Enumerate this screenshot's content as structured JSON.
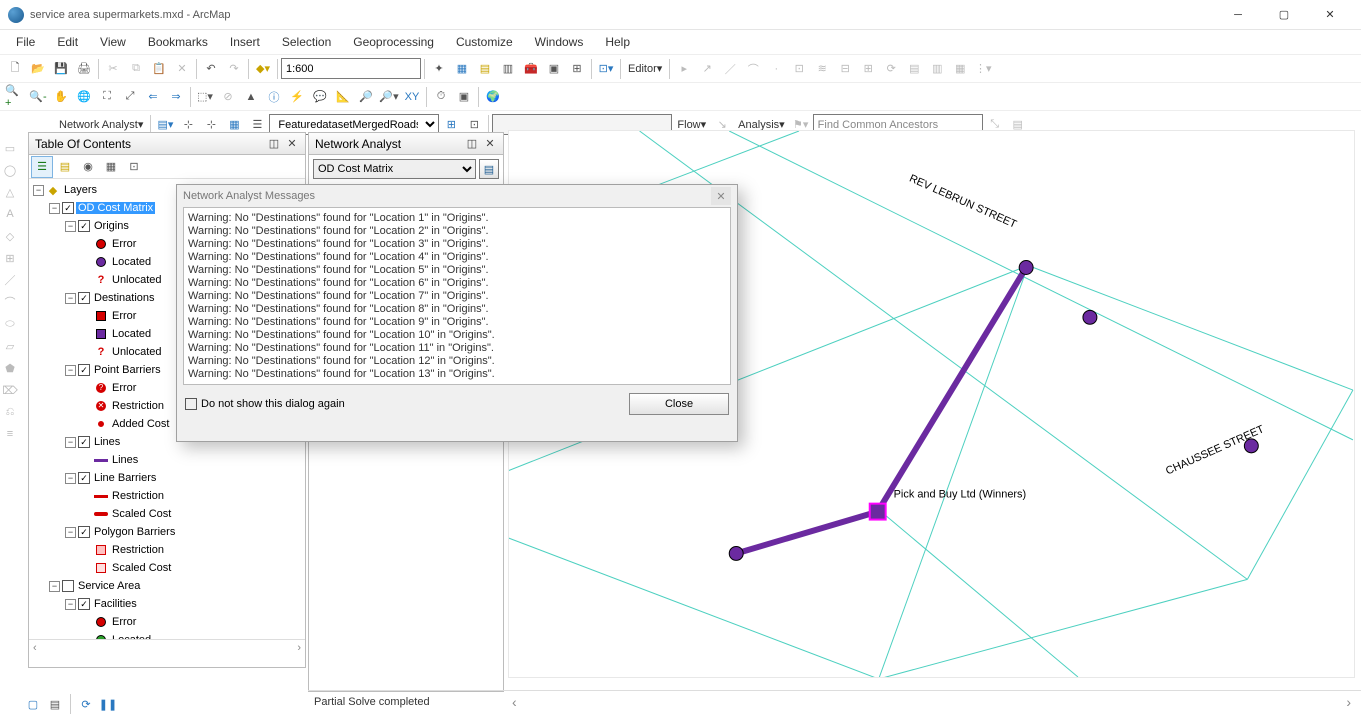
{
  "titlebar": {
    "title": "service area supermarkets.mxd - ArcMap"
  },
  "menubar": [
    "File",
    "Edit",
    "View",
    "Bookmarks",
    "Insert",
    "Selection",
    "Geoprocessing",
    "Customize",
    "Windows",
    "Help"
  ],
  "toolbar1": {
    "scale": "1:600",
    "editor_label": "Editor"
  },
  "toolbar3": {
    "na_label": "Network Analyst",
    "dataset": "FeaturedatasetMergedRoads_",
    "flow_label": "Flow",
    "analysis_label": "Analysis",
    "find_placeholder": "Find Common Ancestors"
  },
  "toc": {
    "title": "Table Of Contents",
    "scroll_left": "‹",
    "scroll_right": "›",
    "tree": [
      {
        "d": 0,
        "exp": "-",
        "chk": null,
        "sym": {
          "t": "layers"
        },
        "label": "Layers"
      },
      {
        "d": 1,
        "exp": "-",
        "chk": true,
        "sym": null,
        "label": "OD Cost Matrix",
        "sel": true
      },
      {
        "d": 2,
        "exp": "-",
        "chk": true,
        "sym": null,
        "label": "Origins"
      },
      {
        "d": 3,
        "exp": null,
        "chk": null,
        "sym": {
          "t": "circle",
          "fill": "#d40000",
          "stroke": "#000"
        },
        "label": "Error"
      },
      {
        "d": 3,
        "exp": null,
        "chk": null,
        "sym": {
          "t": "circle",
          "fill": "#6b2aa0",
          "stroke": "#000"
        },
        "label": "Located"
      },
      {
        "d": 3,
        "exp": null,
        "chk": null,
        "sym": {
          "t": "qmark",
          "color": "#d40000"
        },
        "label": "Unlocated"
      },
      {
        "d": 2,
        "exp": "-",
        "chk": true,
        "sym": null,
        "label": "Destinations"
      },
      {
        "d": 3,
        "exp": null,
        "chk": null,
        "sym": {
          "t": "square",
          "fill": "#d40000",
          "stroke": "#000"
        },
        "label": "Error"
      },
      {
        "d": 3,
        "exp": null,
        "chk": null,
        "sym": {
          "t": "square",
          "fill": "#6b2aa0",
          "stroke": "#000"
        },
        "label": "Located"
      },
      {
        "d": 3,
        "exp": null,
        "chk": null,
        "sym": {
          "t": "qmark",
          "color": "#d40000"
        },
        "label": "Unlocated"
      },
      {
        "d": 2,
        "exp": "-",
        "chk": true,
        "sym": null,
        "label": "Point Barriers"
      },
      {
        "d": 3,
        "exp": null,
        "chk": null,
        "sym": {
          "t": "circleQ",
          "fill": "#d40000"
        },
        "label": "Error"
      },
      {
        "d": 3,
        "exp": null,
        "chk": null,
        "sym": {
          "t": "circleX",
          "fill": "#d40000"
        },
        "label": "Restriction"
      },
      {
        "d": 3,
        "exp": null,
        "chk": null,
        "sym": {
          "t": "circleRing",
          "fill": "#d40000"
        },
        "label": "Added Cost"
      },
      {
        "d": 2,
        "exp": "-",
        "chk": true,
        "sym": null,
        "label": "Lines"
      },
      {
        "d": 3,
        "exp": null,
        "chk": null,
        "sym": {
          "t": "line",
          "fill": "#6b2aa0"
        },
        "label": "Lines"
      },
      {
        "d": 2,
        "exp": "-",
        "chk": true,
        "sym": null,
        "label": "Line Barriers"
      },
      {
        "d": 3,
        "exp": null,
        "chk": null,
        "sym": {
          "t": "line",
          "fill": "#d40000"
        },
        "label": "Restriction"
      },
      {
        "d": 3,
        "exp": null,
        "chk": null,
        "sym": {
          "t": "linecap",
          "fill": "#d40000"
        },
        "label": "Scaled Cost"
      },
      {
        "d": 2,
        "exp": "-",
        "chk": true,
        "sym": null,
        "label": "Polygon Barriers"
      },
      {
        "d": 3,
        "exp": null,
        "chk": null,
        "sym": {
          "t": "poly",
          "fill": "#ffc0c0",
          "stroke": "#d40000"
        },
        "label": "Restriction"
      },
      {
        "d": 3,
        "exp": null,
        "chk": null,
        "sym": {
          "t": "poly",
          "fill": "#ffe0e0",
          "stroke": "#d40000"
        },
        "label": "Scaled Cost"
      },
      {
        "d": 1,
        "exp": "-",
        "chk": false,
        "sym": null,
        "label": "Service Area"
      },
      {
        "d": 2,
        "exp": "-",
        "chk": true,
        "sym": null,
        "label": "Facilities"
      },
      {
        "d": 3,
        "exp": null,
        "chk": null,
        "sym": {
          "t": "circle",
          "fill": "#d40000",
          "stroke": "#000"
        },
        "label": "Error"
      },
      {
        "d": 3,
        "exp": null,
        "chk": null,
        "sym": {
          "t": "circle",
          "fill": "#2aa02a",
          "stroke": "#000"
        },
        "label": "Located"
      }
    ]
  },
  "na_panel": {
    "title": "Network Analyst",
    "dropdown": "OD Cost Matrix"
  },
  "messages": {
    "title": "Network Analyst Messages",
    "lines": [
      "Warning: No \"Destinations\" found for \"Location 1\" in \"Origins\".",
      "Warning: No \"Destinations\" found for \"Location 2\" in \"Origins\".",
      "Warning: No \"Destinations\" found for \"Location 3\" in \"Origins\".",
      "Warning: No \"Destinations\" found for \"Location 4\" in \"Origins\".",
      "Warning: No \"Destinations\" found for \"Location 5\" in \"Origins\".",
      "Warning: No \"Destinations\" found for \"Location 6\" in \"Origins\".",
      "Warning: No \"Destinations\" found for \"Location 7\" in \"Origins\".",
      "Warning: No \"Destinations\" found for \"Location 8\" in \"Origins\".",
      "Warning: No \"Destinations\" found for \"Location 9\" in \"Origins\".",
      "Warning: No \"Destinations\" found for \"Location 10\" in \"Origins\".",
      "Warning: No \"Destinations\" found for \"Location 11\" in \"Origins\".",
      "Warning: No \"Destinations\" found for \"Location 12\" in \"Origins\".",
      "Warning: No \"Destinations\" found for \"Location 13\" in \"Origins\"."
    ],
    "checkbox": "Do not show this dialog again",
    "close": "Close"
  },
  "map": {
    "label_poi": "Pick and Buy Ltd (Winners)",
    "label_street1": "REV LEBRUN STREET",
    "label_street2": "CHAUSSEE STREET",
    "colors": {
      "network": "#4dd0c0",
      "line": "#6b2aa0",
      "point": "#6b2aa0",
      "dest_stroke": "#ff00ff"
    }
  },
  "status": {
    "text": "Partial Solve completed"
  }
}
